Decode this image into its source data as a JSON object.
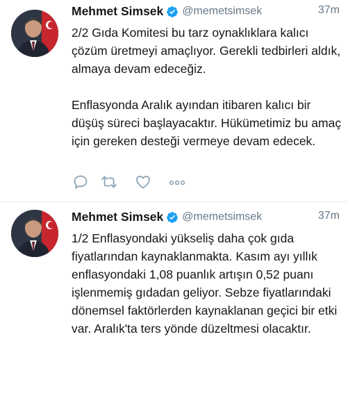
{
  "colors": {
    "text": "#14171a",
    "secondary": "#657786",
    "verified": "#1da1f2",
    "icon": "#8ba3b3",
    "divider": "#e6ecf0"
  },
  "tweets": [
    {
      "author": "Mehmet Simsek",
      "handle": "@memetsimsek",
      "time": "37m",
      "paragraphs": [
        "2/2 Gıda Komitesi bu tarz oynaklıklara kalıcı çözüm üretmeyi amaçlıyor. Gerekli tedbirleri aldık, almaya devam edeceğiz.",
        "Enflasyonda Aralık ayından itibaren kalıcı bir düşüş süreci başlayacaktır. Hükümetimiz bu amaç için gereken desteği vermeye devam edecek."
      ],
      "icons": [
        "reply-icon",
        "retweet-icon",
        "like-icon",
        "more-icon"
      ]
    },
    {
      "author": "Mehmet Simsek",
      "handle": "@memetsimsek",
      "time": "37m",
      "paragraphs": [
        "1/2 Enflasyondaki yükseliş daha çok gıda fiyatlarından kaynaklanmakta. Kasım ayı yıllık enflasyondaki 1,08 puanlık artışın 0,52 puanı işlenmemiş gıdadan geliyor. Sebze fiyatlarındaki dönemsel faktörlerden kaynaklanan geçici bir etki var. Aralık'ta ters yönde düzeltmesi olacaktır."
      ]
    }
  ]
}
